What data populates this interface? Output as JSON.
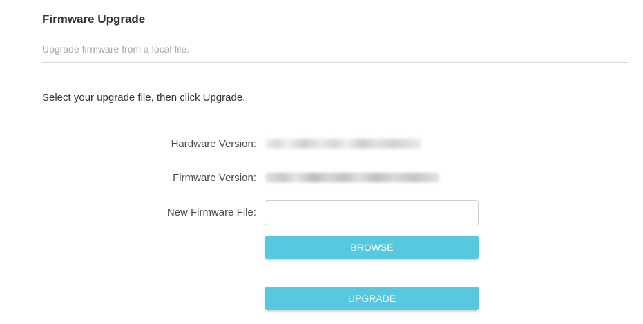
{
  "section": {
    "title": "Firmware Upgrade",
    "subtitle": "Upgrade firmware from a local file."
  },
  "instruction": "Select your upgrade file, then click Upgrade.",
  "form": {
    "hardware_version_label": "Hardware Version:",
    "firmware_version_label": "Firmware Version:",
    "new_firmware_file_label": "New Firmware File:",
    "new_firmware_file_value": "",
    "browse_label": "BROWSE",
    "upgrade_label": "UPGRADE"
  },
  "colors": {
    "button_bg": "#56c9df",
    "button_text": "#ffffff",
    "title_text": "#333333",
    "subtitle_text": "#a5a5a5"
  }
}
